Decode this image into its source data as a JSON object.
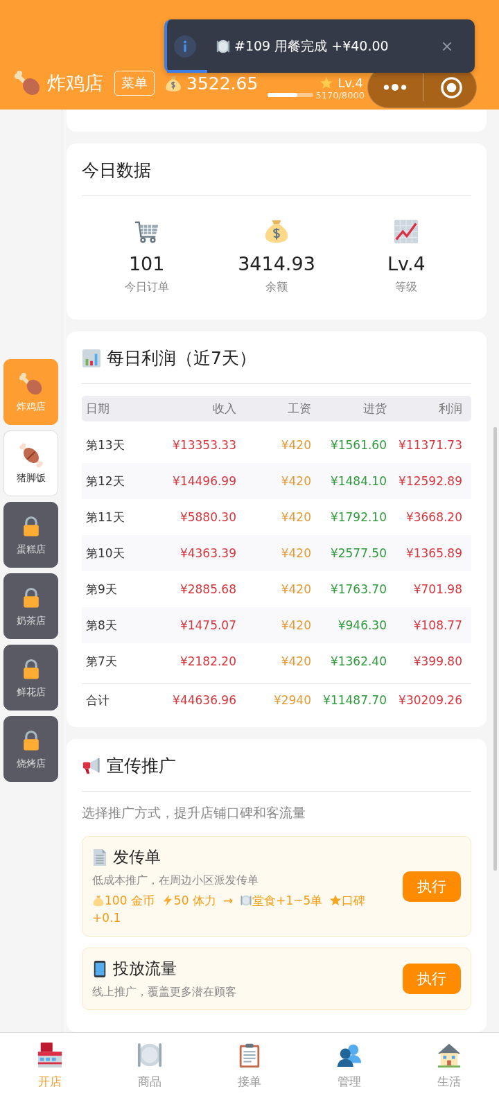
{
  "header": {
    "shop_name": "炸鸡店",
    "menu_button": "菜单",
    "coins": "3522.65",
    "level": "Lv.4",
    "xp": {
      "level": 0.65,
      "reading": "5170/8000"
    }
  },
  "toast": {
    "message": "#109 用餐完成 +¥40.00",
    "level": 0.13
  },
  "shops": [
    {
      "name": "炸鸡店",
      "locked": false,
      "selected": true
    },
    {
      "name": "猪脚饭",
      "locked": false,
      "selected": false
    },
    {
      "name": "蛋糕店",
      "locked": true,
      "selected": false
    },
    {
      "name": "奶茶店",
      "locked": true,
      "selected": false
    },
    {
      "name": "鲜花店",
      "locked": true,
      "selected": false
    },
    {
      "name": "烧烤店",
      "locked": true,
      "selected": false
    }
  ],
  "today": {
    "title": "今日数据",
    "stats": [
      {
        "value": "101",
        "label": "今日订单"
      },
      {
        "value": "3414.93",
        "label": "余额"
      },
      {
        "value": "Lv.4",
        "label": "等级"
      }
    ]
  },
  "profit": {
    "title": "每日利润（近7天）",
    "columns": [
      "日期",
      "收入",
      "工资",
      "进货",
      "利润"
    ],
    "rows": [
      [
        "第13天",
        "¥13353.33",
        "¥420",
        "¥1561.60",
        "¥11371.73"
      ],
      [
        "第12天",
        "¥14496.99",
        "¥420",
        "¥1484.10",
        "¥12592.89"
      ],
      [
        "第11天",
        "¥5880.30",
        "¥420",
        "¥1792.10",
        "¥3668.20"
      ],
      [
        "第10天",
        "¥4363.39",
        "¥420",
        "¥2577.50",
        "¥1365.89"
      ],
      [
        "第9天",
        "¥2885.68",
        "¥420",
        "¥1763.70",
        "¥701.98"
      ],
      [
        "第8天",
        "¥1475.07",
        "¥420",
        "¥946.30",
        "¥108.77"
      ],
      [
        "第7天",
        "¥2182.20",
        "¥420",
        "¥1362.40",
        "¥399.80"
      ]
    ],
    "total": [
      "合计",
      "¥44636.96",
      "¥2940",
      "¥11487.70",
      "¥30209.26"
    ]
  },
  "promotion": {
    "title": "宣传推广",
    "subtitle": "选择推广方式，提升店铺口碑和客流量",
    "actions": [
      {
        "title": "发传单",
        "description": "低成本推广，在周边小区派发传单",
        "effects": [
          {
            "kind": "coin",
            "text": "100 金币"
          },
          {
            "kind": "energy",
            "text": "50 体力"
          },
          {
            "kind": "arrow",
            "text": "→"
          },
          {
            "kind": "dine",
            "text": "堂食+1~5单"
          },
          {
            "kind": "rating",
            "text": "口碑+0.1"
          }
        ],
        "button": "执行"
      },
      {
        "title": "投放流量",
        "description": "线上推广，覆盖更多潜在顾客",
        "button": "执行"
      }
    ]
  },
  "nav": [
    {
      "label": "开店",
      "selected": true
    },
    {
      "label": "商品",
      "selected": false
    },
    {
      "label": "接单",
      "selected": false
    },
    {
      "label": "管理",
      "selected": false
    },
    {
      "label": "生活",
      "selected": false
    }
  ]
}
